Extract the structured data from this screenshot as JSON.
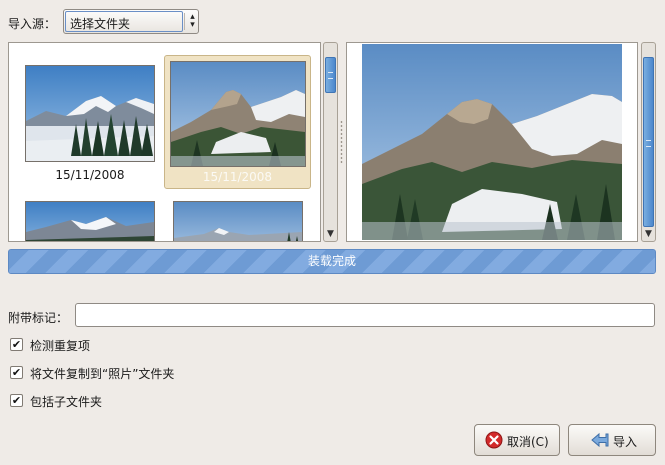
{
  "source": {
    "label": "导入源：",
    "selected": "选择文件夹"
  },
  "thumbnails": [
    {
      "date": "15/11/2008",
      "selected": false
    },
    {
      "date": "15/11/2008",
      "selected": true
    },
    {
      "date": "",
      "selected": false
    },
    {
      "date": "",
      "selected": false
    }
  ],
  "progress": {
    "text": "装载完成",
    "fraction": 1.0
  },
  "tags": {
    "label": "附带标记：",
    "value": ""
  },
  "options": [
    {
      "label": "检测重复项",
      "checked": true
    },
    {
      "label": "将文件复制到“照片”文件夹",
      "checked": true
    },
    {
      "label": "包括子文件夹",
      "checked": true
    }
  ],
  "buttons": {
    "cancel": "取消(C)",
    "import": "导入"
  },
  "colors": {
    "accent": "#6e9bd4",
    "selection": "#f0e3c4"
  },
  "icons": {
    "cancel": "cancel-icon",
    "import": "import-arrow-icon",
    "checkmark": "checkmark-icon"
  }
}
